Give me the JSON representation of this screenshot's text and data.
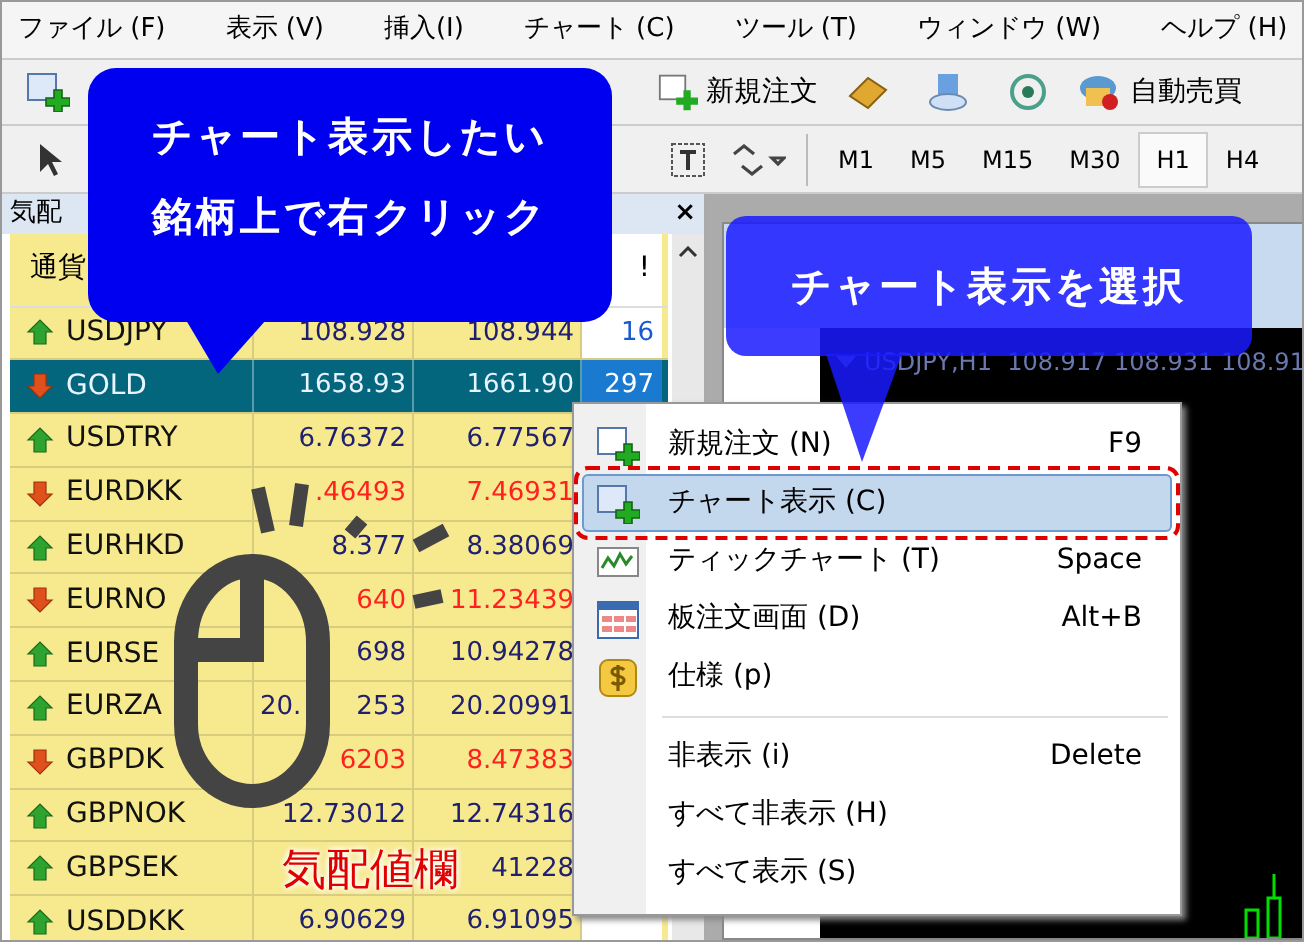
{
  "menu_bar": [
    {
      "label": "ファイル (F)"
    },
    {
      "label": "表示 (V)"
    },
    {
      "label": "挿入(I)"
    },
    {
      "label": "チャート (C)"
    },
    {
      "label": "ツール (T)"
    },
    {
      "label": "ウィンドウ (W)"
    },
    {
      "label": "ヘルプ (H)"
    }
  ],
  "toolbar": {
    "new_order": "新規注文",
    "auto_trading": "自動売買"
  },
  "timeframes": [
    {
      "label": "M1",
      "selected": false
    },
    {
      "label": "M5",
      "selected": false
    },
    {
      "label": "M15",
      "selected": false
    },
    {
      "label": "M30",
      "selected": false
    },
    {
      "label": "H1",
      "selected": true
    },
    {
      "label": "H4",
      "selected": false
    }
  ],
  "market_watch": {
    "title": "気配",
    "close": "×",
    "symbol_header": "通貨",
    "spread_header": "!",
    "rows": [
      {
        "symbol": "USDJPY",
        "kind": "up",
        "bid": "108.928",
        "ask": "108.944",
        "spread": "16",
        "selected": false
      },
      {
        "symbol": "GOLD",
        "kind": "down",
        "bid": "1658.93",
        "ask": "1661.90",
        "spread": "297",
        "selected": true
      },
      {
        "symbol": "USDTRY",
        "kind": "up",
        "bid": "6.76372",
        "ask": "6.77567",
        "selected": false
      },
      {
        "symbol": "EURDKK",
        "kind": "down",
        "bid": ".46493",
        "ask": "7.46931",
        "selected": false
      },
      {
        "symbol": "EURHKD",
        "kind": "up",
        "bid": "8.377",
        "ask": "8.38069",
        "selected": false
      },
      {
        "symbol": "EURNO",
        "kind": "down",
        "bid": "640",
        "ask": "11.23439",
        "selected": false
      },
      {
        "symbol": "EURSE",
        "kind": "up",
        "bid": "698",
        "ask": "10.94278",
        "selected": false
      },
      {
        "symbol": "EURZA",
        "kind": "up",
        "bid_fragment": "20.",
        "bid": "253",
        "ask": "20.20991",
        "selected": false
      },
      {
        "symbol": "GBPDK",
        "kind": "down",
        "bid": "6203",
        "ask": "8.47383",
        "selected": false
      },
      {
        "symbol": "GBPNOK",
        "kind": "up",
        "bid": "12.73012",
        "ask": "12.74316",
        "selected": false
      },
      {
        "symbol": "GBPSEK",
        "kind": "up",
        "ask": "41228",
        "selected": false
      },
      {
        "symbol": "USDDKK",
        "kind": "up",
        "bid": "6.90629",
        "ask": "6.91095",
        "selected": false
      }
    ]
  },
  "chart": {
    "header": "USDJPY,H1  108.917 108.931 108.91"
  },
  "context_menu": [
    {
      "kind": "order",
      "label": "新規注文 (N)",
      "shortcut": "F9",
      "selected": false
    },
    {
      "kind": "chart",
      "label": "チャート表示 (C)",
      "selected": true
    },
    {
      "kind": "tick",
      "label": "ティックチャート (T)",
      "shortcut": "Space",
      "selected": false
    },
    {
      "kind": "depth",
      "label": "板注文画面 (D)",
      "shortcut": "Alt+B",
      "selected": false
    },
    {
      "kind": "spec",
      "label": "仕様 (p)",
      "selected": false
    },
    {
      "kind": "separator"
    },
    {
      "kind": "plain",
      "label": "非表示 (i)",
      "shortcut": "Delete",
      "selected": false
    },
    {
      "kind": "plain",
      "label": "すべて非表示 (H)",
      "selected": false
    },
    {
      "kind": "plain",
      "label": "すべて表示 (S)",
      "selected": false
    }
  ],
  "callouts": [
    {
      "lines": [
        "チャート表示したい",
        "銘柄上で右クリック"
      ]
    },
    {
      "lines": [
        "チャート表示を選択"
      ]
    }
  ],
  "annotation_label": "気配値欄"
}
